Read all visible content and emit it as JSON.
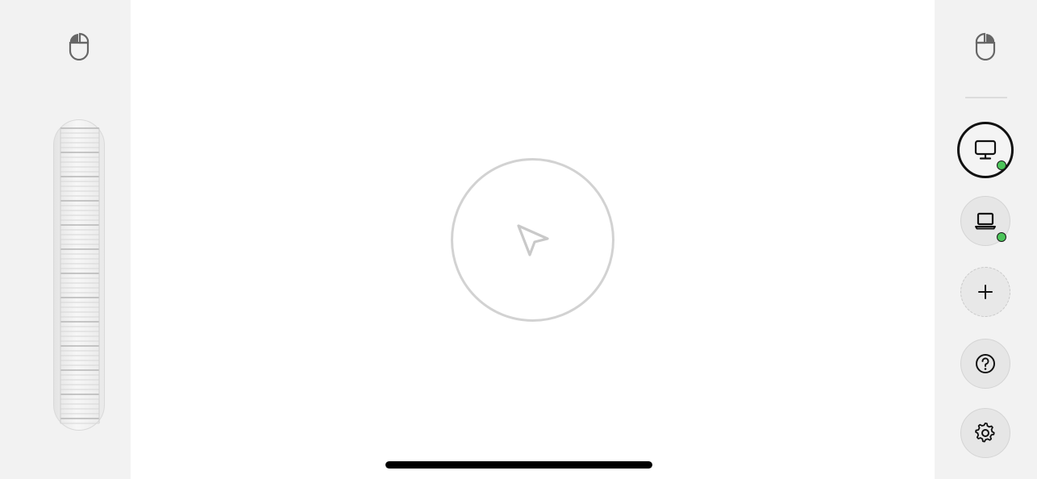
{
  "colors": {
    "panel_background": "#f2f2f2",
    "canvas_background": "#ffffff",
    "online_status": "#4cc45a",
    "icon_gray": "#666666"
  },
  "left_panel": {
    "mouse_icon": "mouse-icon",
    "scroll_wheel_icon": "scroll-wheel"
  },
  "trackpad": {
    "center_icon": "cursor-arrow-icon"
  },
  "right_panel": {
    "mouse_icon": "mouse-icon",
    "devices": [
      {
        "icon": "desktop-icon",
        "status": "online",
        "selected": true
      },
      {
        "icon": "laptop-icon",
        "status": "online",
        "selected": false
      }
    ],
    "actions": [
      {
        "icon": "plus-icon"
      },
      {
        "icon": "help-icon"
      },
      {
        "icon": "gear-icon"
      }
    ]
  }
}
